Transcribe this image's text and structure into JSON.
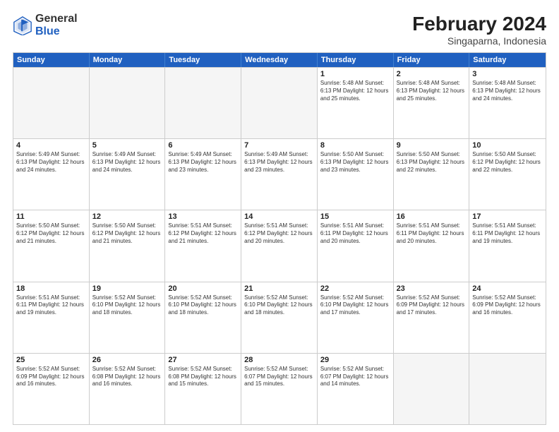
{
  "header": {
    "logo_general": "General",
    "logo_blue": "Blue",
    "title": "February 2024",
    "subtitle": "Singaparna, Indonesia"
  },
  "days": [
    "Sunday",
    "Monday",
    "Tuesday",
    "Wednesday",
    "Thursday",
    "Friday",
    "Saturday"
  ],
  "weeks": [
    [
      {
        "num": "",
        "empty": true
      },
      {
        "num": "",
        "empty": true
      },
      {
        "num": "",
        "empty": true
      },
      {
        "num": "",
        "empty": true
      },
      {
        "num": "1",
        "info": "Sunrise: 5:48 AM\nSunset: 6:13 PM\nDaylight: 12 hours\nand 25 minutes."
      },
      {
        "num": "2",
        "info": "Sunrise: 5:48 AM\nSunset: 6:13 PM\nDaylight: 12 hours\nand 25 minutes."
      },
      {
        "num": "3",
        "info": "Sunrise: 5:48 AM\nSunset: 6:13 PM\nDaylight: 12 hours\nand 24 minutes."
      }
    ],
    [
      {
        "num": "4",
        "info": "Sunrise: 5:49 AM\nSunset: 6:13 PM\nDaylight: 12 hours\nand 24 minutes."
      },
      {
        "num": "5",
        "info": "Sunrise: 5:49 AM\nSunset: 6:13 PM\nDaylight: 12 hours\nand 24 minutes."
      },
      {
        "num": "6",
        "info": "Sunrise: 5:49 AM\nSunset: 6:13 PM\nDaylight: 12 hours\nand 23 minutes."
      },
      {
        "num": "7",
        "info": "Sunrise: 5:49 AM\nSunset: 6:13 PM\nDaylight: 12 hours\nand 23 minutes."
      },
      {
        "num": "8",
        "info": "Sunrise: 5:50 AM\nSunset: 6:13 PM\nDaylight: 12 hours\nand 23 minutes."
      },
      {
        "num": "9",
        "info": "Sunrise: 5:50 AM\nSunset: 6:13 PM\nDaylight: 12 hours\nand 22 minutes."
      },
      {
        "num": "10",
        "info": "Sunrise: 5:50 AM\nSunset: 6:12 PM\nDaylight: 12 hours\nand 22 minutes."
      }
    ],
    [
      {
        "num": "11",
        "info": "Sunrise: 5:50 AM\nSunset: 6:12 PM\nDaylight: 12 hours\nand 21 minutes."
      },
      {
        "num": "12",
        "info": "Sunrise: 5:50 AM\nSunset: 6:12 PM\nDaylight: 12 hours\nand 21 minutes."
      },
      {
        "num": "13",
        "info": "Sunrise: 5:51 AM\nSunset: 6:12 PM\nDaylight: 12 hours\nand 21 minutes."
      },
      {
        "num": "14",
        "info": "Sunrise: 5:51 AM\nSunset: 6:12 PM\nDaylight: 12 hours\nand 20 minutes."
      },
      {
        "num": "15",
        "info": "Sunrise: 5:51 AM\nSunset: 6:11 PM\nDaylight: 12 hours\nand 20 minutes."
      },
      {
        "num": "16",
        "info": "Sunrise: 5:51 AM\nSunset: 6:11 PM\nDaylight: 12 hours\nand 20 minutes."
      },
      {
        "num": "17",
        "info": "Sunrise: 5:51 AM\nSunset: 6:11 PM\nDaylight: 12 hours\nand 19 minutes."
      }
    ],
    [
      {
        "num": "18",
        "info": "Sunrise: 5:51 AM\nSunset: 6:11 PM\nDaylight: 12 hours\nand 19 minutes."
      },
      {
        "num": "19",
        "info": "Sunrise: 5:52 AM\nSunset: 6:10 PM\nDaylight: 12 hours\nand 18 minutes."
      },
      {
        "num": "20",
        "info": "Sunrise: 5:52 AM\nSunset: 6:10 PM\nDaylight: 12 hours\nand 18 minutes."
      },
      {
        "num": "21",
        "info": "Sunrise: 5:52 AM\nSunset: 6:10 PM\nDaylight: 12 hours\nand 18 minutes."
      },
      {
        "num": "22",
        "info": "Sunrise: 5:52 AM\nSunset: 6:10 PM\nDaylight: 12 hours\nand 17 minutes."
      },
      {
        "num": "23",
        "info": "Sunrise: 5:52 AM\nSunset: 6:09 PM\nDaylight: 12 hours\nand 17 minutes."
      },
      {
        "num": "24",
        "info": "Sunrise: 5:52 AM\nSunset: 6:09 PM\nDaylight: 12 hours\nand 16 minutes."
      }
    ],
    [
      {
        "num": "25",
        "info": "Sunrise: 5:52 AM\nSunset: 6:09 PM\nDaylight: 12 hours\nand 16 minutes."
      },
      {
        "num": "26",
        "info": "Sunrise: 5:52 AM\nSunset: 6:08 PM\nDaylight: 12 hours\nand 16 minutes."
      },
      {
        "num": "27",
        "info": "Sunrise: 5:52 AM\nSunset: 6:08 PM\nDaylight: 12 hours\nand 15 minutes."
      },
      {
        "num": "28",
        "info": "Sunrise: 5:52 AM\nSunset: 6:07 PM\nDaylight: 12 hours\nand 15 minutes."
      },
      {
        "num": "29",
        "info": "Sunrise: 5:52 AM\nSunset: 6:07 PM\nDaylight: 12 hours\nand 14 minutes."
      },
      {
        "num": "",
        "empty": true
      },
      {
        "num": "",
        "empty": true
      }
    ]
  ]
}
